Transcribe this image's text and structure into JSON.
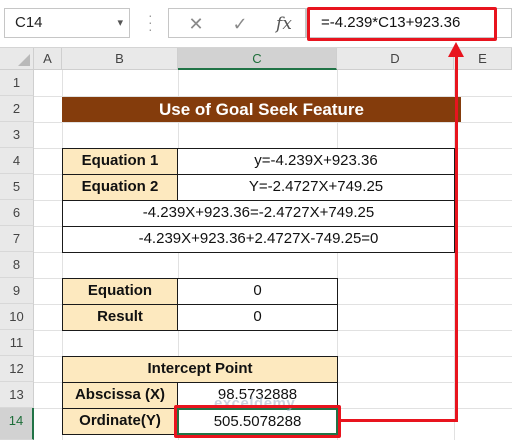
{
  "formula_bar": {
    "name_box": "C14",
    "cancel_symbol": "✕",
    "enter_symbol": "✓",
    "fx_symbol": "fx",
    "formula": "=-4.239*C13+923.36"
  },
  "columns": [
    "A",
    "B",
    "C",
    "D",
    "E"
  ],
  "rows": [
    "1",
    "2",
    "3",
    "4",
    "5",
    "6",
    "7",
    "8",
    "9",
    "10",
    "11",
    "12",
    "13",
    "14"
  ],
  "active_cell": {
    "column": "C",
    "row": "14"
  },
  "sheet": {
    "title": "Use of Goal Seek Feature",
    "equation1_label": "Equation 1",
    "equation1_value": "y=-4.239X+923.36",
    "equation2_label": "Equation 2",
    "equation2_value": "Y=-2.4727X+749.25",
    "row6_text": "-4.239X+923.36=-2.4727X+749.25",
    "row7_text": "-4.239X+923.36+2.4727X-749.25=0",
    "equation_label": "Equation",
    "equation_value": "0",
    "result_label": "Result",
    "result_value": "0",
    "intercept_header": "Intercept Point",
    "abscissa_label": "Abscissa (X)",
    "abscissa_value": "98.5732888",
    "ordinate_label": "Ordinate(Y)",
    "ordinate_value": "505.5078288"
  },
  "watermark": "exceldemy",
  "colors": {
    "title_bg": "#843c0c",
    "label_bg": "#fde9bf",
    "highlight": "#e8141e",
    "selection": "#217346"
  }
}
